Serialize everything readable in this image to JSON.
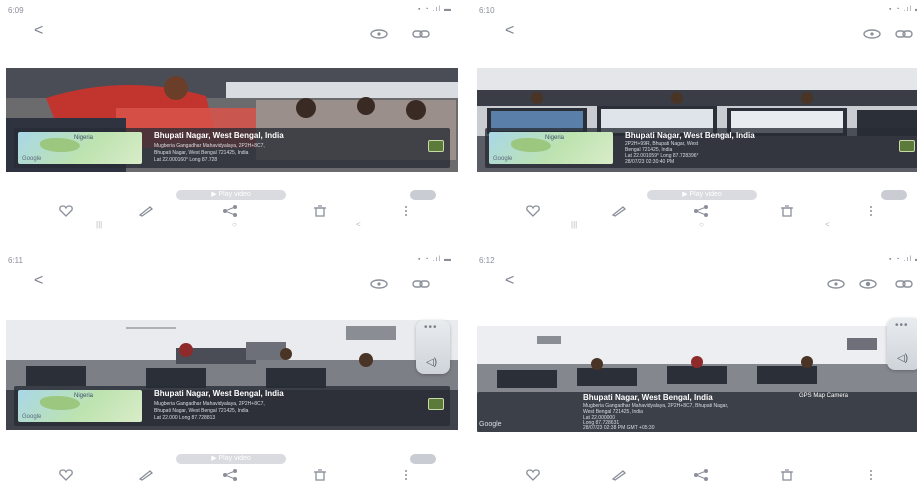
{
  "panels": [
    {
      "status_time": "6:09",
      "overlay": {
        "map_label": "Nigeria",
        "map_logo": "Google",
        "title": "Bhupati Nagar, West Bengal, India",
        "line1": "Mugberia Gangadhar Mahavidyalaya, 2P2H+8C7,",
        "line2": "Bhupati Nagar, West Bengal 721425, India",
        "line3": "Lat 22.000160° Long 87.728"
      },
      "play_label": "▶ Play video"
    },
    {
      "status_time": "6:10",
      "overlay": {
        "map_label": "Nigeria",
        "map_logo": "Google",
        "title": "Bhupati Nagar, West Bengal, India",
        "line1": "2P2H+99R, Bhupati Nagar, West",
        "line2": "Bengal 721425, India",
        "line3": "Lat 22.001059° Long 87.728396°",
        "line4": "28/07/23 02:30:40 PM"
      },
      "play_label": "▶ Play video"
    },
    {
      "status_time": "6:11",
      "overlay": {
        "map_label": "Nigeria",
        "map_logo": "Google",
        "title": "Bhupati Nagar, West Bengal, India",
        "line1": "Mugberia Gangadhar Mahavidyalaya, 2P2H+8C7,",
        "line2": "Bhupati Nagar, West Bengal 721425, India",
        "line3": "Lat 22.000 Long 87.728813"
      },
      "play_label": "▶ Play video"
    },
    {
      "status_time": "6:12",
      "overlay": {
        "brand": "GPS Map Camera",
        "map_logo": "Google",
        "title": "Bhupati Nagar, West Bengal, India",
        "line1": "Mugberia Gangadhar Mahavidyalaya, 2P2H+8C7, Bhupati Nagar,",
        "line2": "West Bengal 721425, India",
        "line3": "Lat 22.000000",
        "line4": "Long 87.728631",
        "line5": "28/07/23 02:38 PM GMT +05:30"
      }
    }
  ],
  "nav": {
    "recents": "|||",
    "home": "○",
    "back": "<"
  },
  "topbar": {
    "back": "<"
  }
}
